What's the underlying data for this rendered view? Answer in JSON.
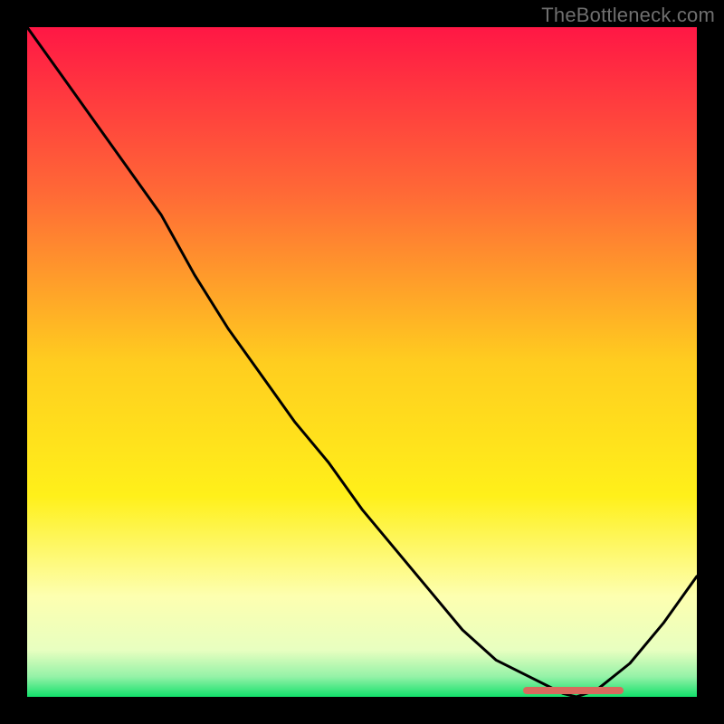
{
  "attribution": "TheBottleneck.com",
  "chart_data": {
    "type": "line",
    "title": "",
    "xlabel": "",
    "ylabel": "",
    "x": [
      0.0,
      0.05,
      0.1,
      0.15,
      0.2,
      0.25,
      0.3,
      0.35,
      0.4,
      0.45,
      0.5,
      0.55,
      0.6,
      0.65,
      0.7,
      0.75,
      0.8,
      0.82,
      0.85,
      0.9,
      0.95,
      1.0
    ],
    "y": [
      1.0,
      0.93,
      0.86,
      0.79,
      0.72,
      0.63,
      0.55,
      0.48,
      0.41,
      0.35,
      0.28,
      0.22,
      0.16,
      0.1,
      0.055,
      0.03,
      0.005,
      0.0,
      0.01,
      0.05,
      0.11,
      0.18
    ],
    "xlim": [
      0,
      1
    ],
    "ylim": [
      0,
      1
    ],
    "minimum_marker": {
      "x_start": 0.74,
      "x_end": 0.89,
      "label": ""
    },
    "gradient_stops": [
      {
        "offset": 0.0,
        "color": "#ff1745"
      },
      {
        "offset": 0.25,
        "color": "#ff6a36"
      },
      {
        "offset": 0.5,
        "color": "#ffcd1f"
      },
      {
        "offset": 0.7,
        "color": "#fff01a"
      },
      {
        "offset": 0.85,
        "color": "#fdffb0"
      },
      {
        "offset": 0.93,
        "color": "#e8ffc0"
      },
      {
        "offset": 0.97,
        "color": "#94f2a7"
      },
      {
        "offset": 1.0,
        "color": "#12e06b"
      }
    ]
  }
}
